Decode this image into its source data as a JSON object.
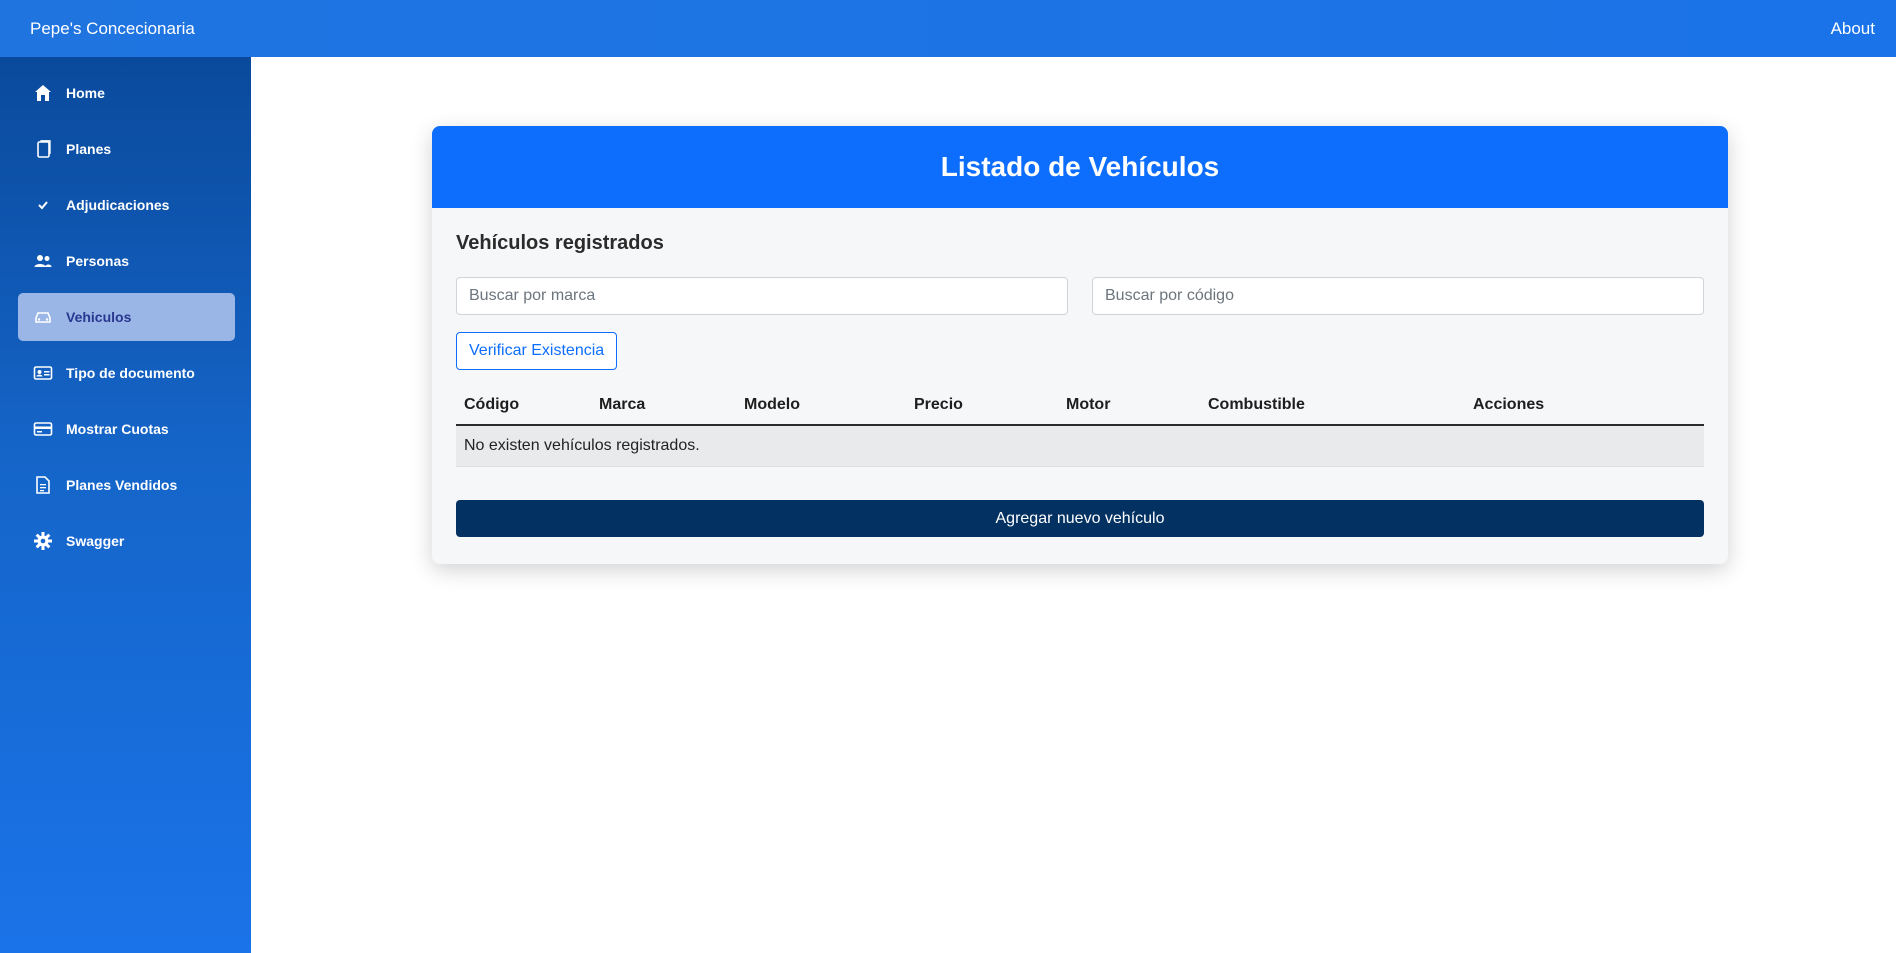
{
  "header": {
    "brand": "Pepe's Concecionaria",
    "about": "About"
  },
  "sidebar": {
    "items": [
      {
        "label": "Home",
        "icon": "home-icon"
      },
      {
        "label": "Planes",
        "icon": "document-icon"
      },
      {
        "label": "Adjudicaciones",
        "icon": "check-icon"
      },
      {
        "label": "Personas",
        "icon": "people-icon"
      },
      {
        "label": "Vehiculos",
        "icon": "car-icon",
        "active": true
      },
      {
        "label": "Tipo de documento",
        "icon": "id-card-icon"
      },
      {
        "label": "Mostrar Cuotas",
        "icon": "credit-card-icon"
      },
      {
        "label": "Planes Vendidos",
        "icon": "file-text-icon"
      },
      {
        "label": "Swagger",
        "icon": "gear-icon"
      }
    ]
  },
  "main": {
    "title": "Listado de Vehículos",
    "subtitle": "Vehículos registrados",
    "search_brand_placeholder": "Buscar por marca",
    "search_code_placeholder": "Buscar por código",
    "verify_button": "Verificar Existencia",
    "table": {
      "columns": [
        "Código",
        "Marca",
        "Modelo",
        "Precio",
        "Motor",
        "Combustible",
        "Acciones"
      ],
      "empty_message": "No existen vehículos registrados."
    },
    "add_button": "Agregar nuevo vehículo"
  },
  "colors": {
    "topbar": "#1a73e8",
    "card_header": "#0d6efd",
    "add_button": "#023162",
    "active_item_bg": "#9ab6e6"
  }
}
